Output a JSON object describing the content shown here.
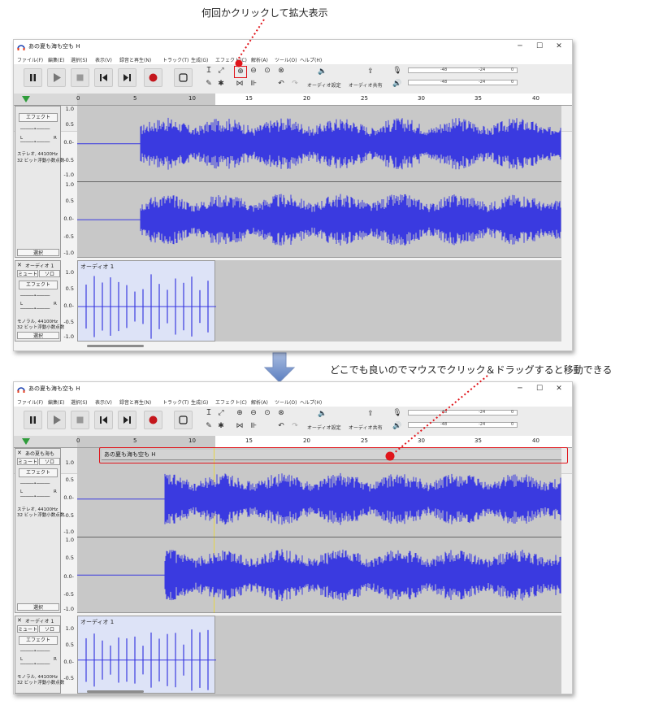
{
  "captions": {
    "top": "何回かクリックして拡大表示",
    "middle": "どこでも良いのでマウスでクリック＆ドラッグすると移動できる"
  },
  "window": {
    "title": "あの夏も海も空も H",
    "minimize": "─",
    "maximize": "☐",
    "close": "✕"
  },
  "menu": [
    "ファイル(F)",
    "編集(E)",
    "選択(S)",
    "表示(V)",
    "録音と再生(N)",
    "トラック(T)",
    "生成(G)",
    "エフェクト(C)",
    "解析(A)",
    "ツール(O)",
    "ヘルプ(H)"
  ],
  "toolbar": {
    "audio_setup": "オーディオ設定",
    "share_audio": "オーディオ共有",
    "meter_ticks": [
      "-48",
      "-24",
      "0"
    ],
    "channel_l": "L",
    "channel_r": "R"
  },
  "ruler": [
    "0",
    "5",
    "10",
    "15",
    "20",
    "25",
    "30",
    "35",
    "40"
  ],
  "amp_labels_stereo": [
    "1.0",
    "0.5",
    "0.0-",
    "-0.5",
    "-1.0",
    "1.0",
    "0.5",
    "0.0-",
    "-0.5",
    "-1.0"
  ],
  "amp_labels_mono": [
    "1.0",
    "0.5",
    "0.0-",
    "-0.5",
    "-1.0"
  ],
  "track1": {
    "name": "あの夏も海も",
    "mute": "ミュート",
    "solo": "ソロ",
    "effect": "エフェクト",
    "l": "L",
    "r": "R",
    "info1": "ステレオ, 44100Hz",
    "info2": "32 ビット浮動小数点数",
    "select": "選択",
    "clip_title": "あの夏も海も空も H"
  },
  "track2": {
    "name": "オーディオ 1",
    "mute": "ミュート",
    "solo": "ソロ",
    "effect": "エフェクト",
    "l": "L",
    "r": "R",
    "info1": "モノラル, 44100Hz",
    "info2": "32 ビット浮動小数点数",
    "select": "選択",
    "clip_title": "オーディオ 1"
  },
  "colors": {
    "waveform": "#3a3ae0",
    "track_bg": "#c8c8c8",
    "clip_bg": "#dde3f7",
    "annotation_red": "#e0151b",
    "arrow_blue": "#6d8fc8"
  }
}
